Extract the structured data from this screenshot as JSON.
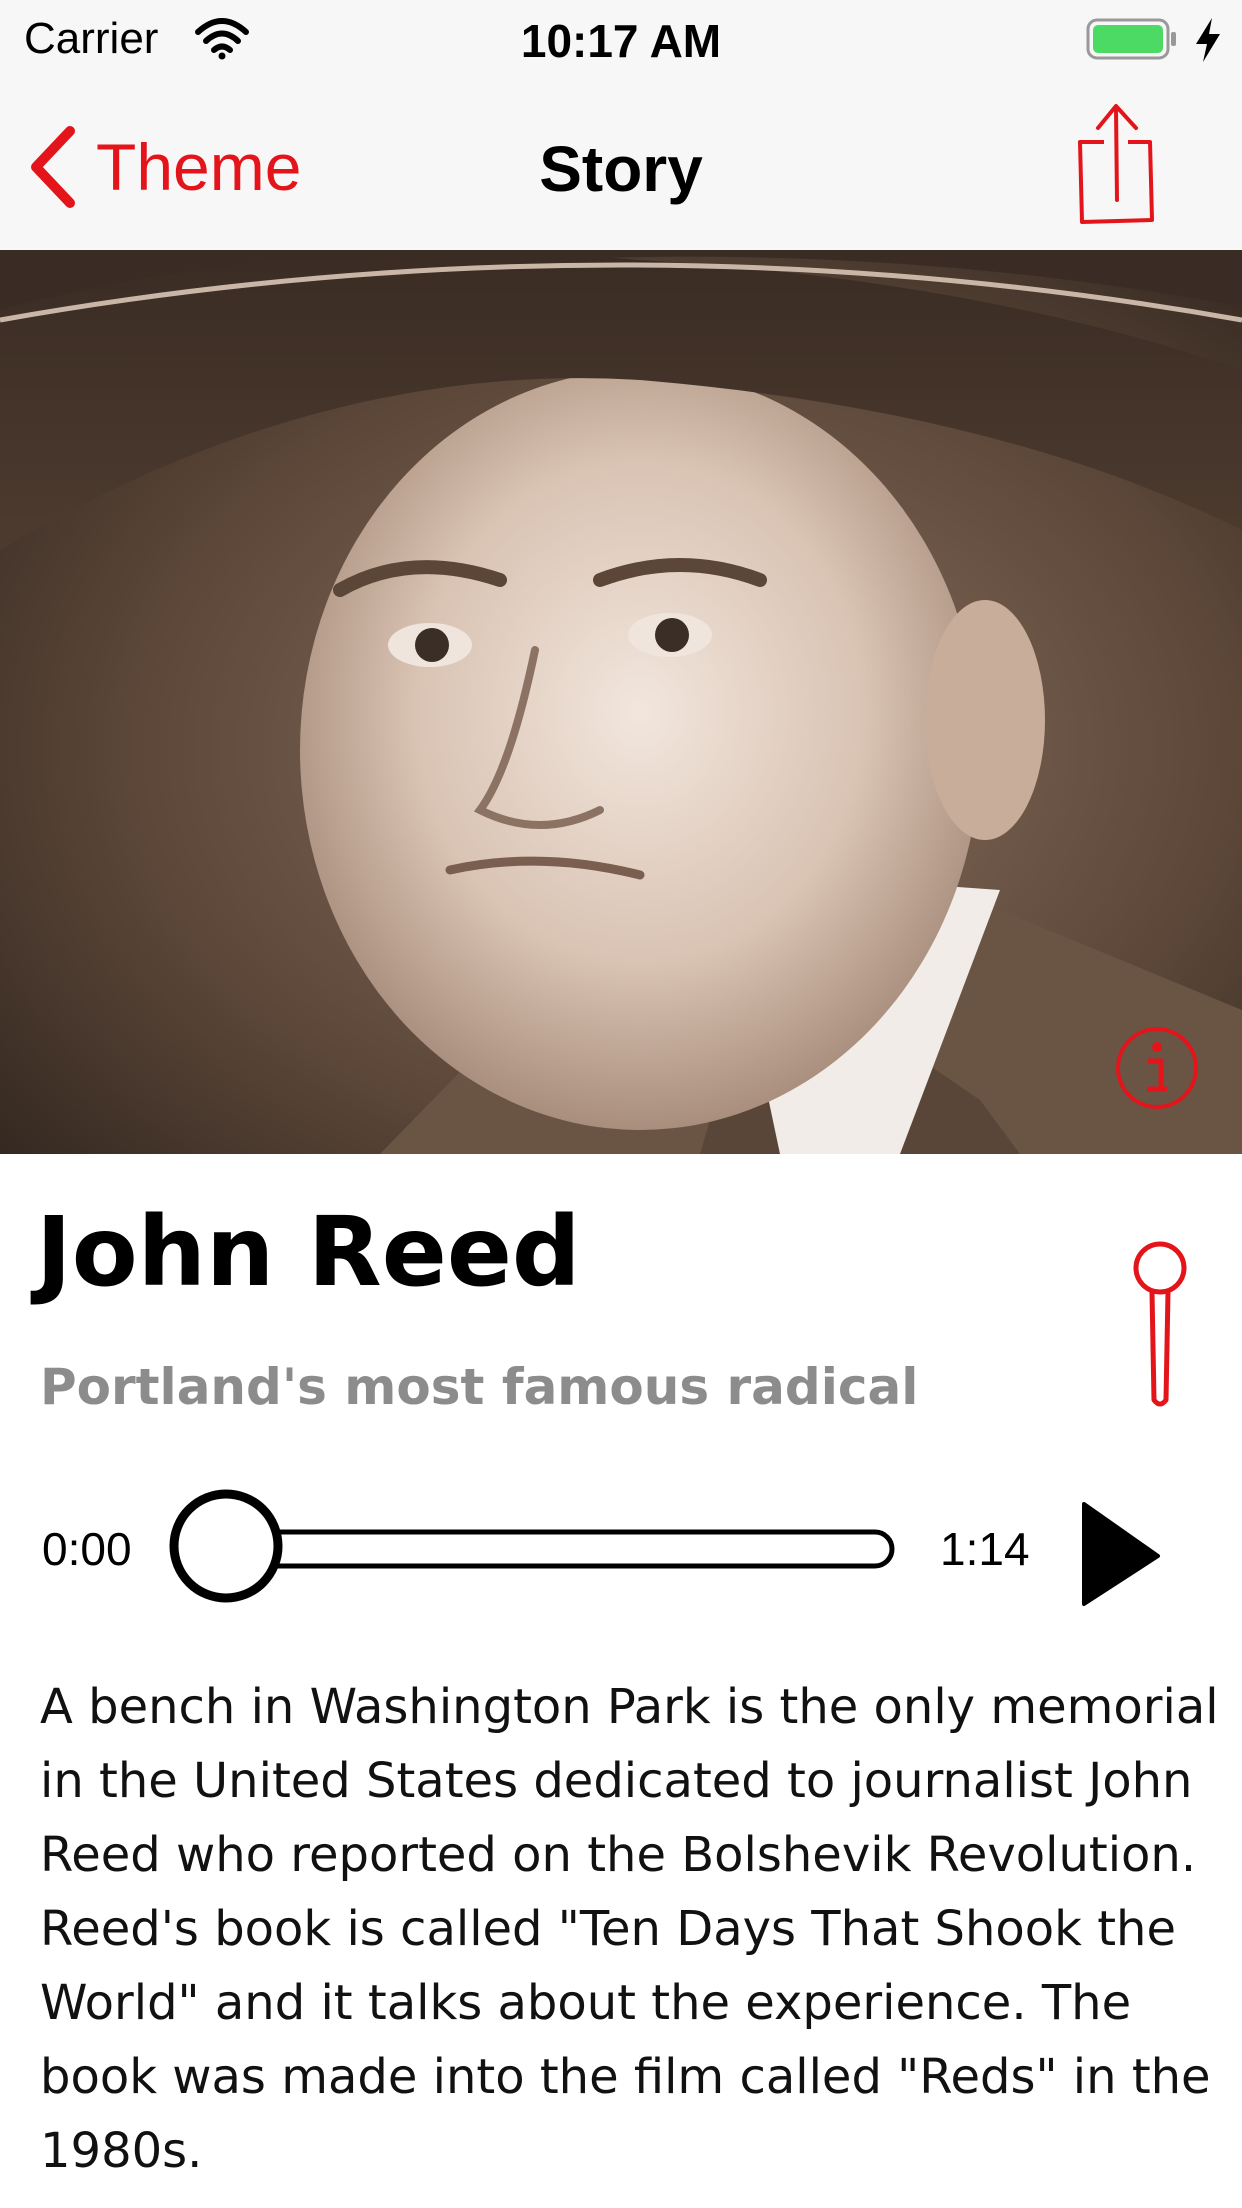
{
  "status_bar": {
    "carrier": "Carrier",
    "time": "10:17 AM",
    "battery_color": "#4cd964",
    "icons": [
      "wifi-icon",
      "battery-icon",
      "charging-bolt-icon"
    ]
  },
  "nav": {
    "back_label": "Theme",
    "title": "Story",
    "accent_color": "#e4141b",
    "icons": [
      "chevron-left-icon",
      "share-icon"
    ]
  },
  "hero": {
    "image_description_icon": "portrait-photo",
    "info_icon": "info-icon"
  },
  "story": {
    "title": "John Reed",
    "subtitle": "Portland's most famous radical",
    "pin_icon": "map-pin-icon",
    "body": "A bench in Washington Park is the only memorial in the United States dedicated to journalist John Reed who reported on the Bolshevik Revolution. Reed's book is called \"Ten Days That Shook the World\"  and it talks about the experience. The book was made into the film called \"Reds\" in the 1980s."
  },
  "audio": {
    "current_time": "0:00",
    "total_time": "1:14",
    "progress": 0,
    "play_icon": "play-icon"
  }
}
